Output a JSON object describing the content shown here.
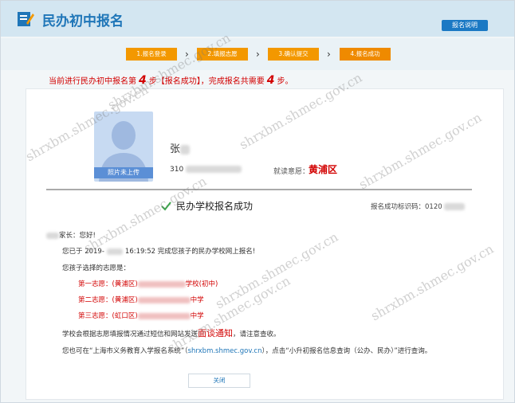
{
  "header": {
    "title": "民办初中报名",
    "help_button": "报名说明"
  },
  "steps": [
    {
      "label": "1.报名登录"
    },
    {
      "label": "2.填报志愿"
    },
    {
      "label": "3.确认提交"
    },
    {
      "label": "4.报名成功"
    }
  ],
  "progress": {
    "prefix": "当前进行民办初中报名第",
    "current": "4",
    "middle": "步【报名成功】，完成报名共需要",
    "total": "4",
    "suffix": "步。"
  },
  "student": {
    "avatar_label": "照片未上传",
    "name_visible": "张",
    "id_prefix": "310",
    "school_label": "就读意愿：",
    "school_value": "黄浦区"
  },
  "result": {
    "title": "民办学校报名成功",
    "serial_label": "报名成功标识码：",
    "serial_prefix": "0120"
  },
  "letter": {
    "greeting_suffix": "家长：您好!",
    "line1_prefix": "您已于 2019-",
    "line1_suffix": "16:19:52 完成您孩子的民办学校网上报名!",
    "choices_title": "您孩子选择的志愿是：",
    "choices": [
      {
        "prefix": "第一志愿：(黄浦区)",
        "suffix": "学校(初中)"
      },
      {
        "prefix": "第二志愿：(黄浦区)",
        "suffix": "中学"
      },
      {
        "prefix": "第三志愿：(虹口区)",
        "suffix": "中学"
      }
    ],
    "notice_prefix": "学校会根据志愿填报情况通过短信和网站发送",
    "notice_highlight": "面谈通知",
    "notice_suffix": "，请注意查收。",
    "query_prefix": "您也可在“上海市义务教育入学报名系统”（",
    "query_link": "shrxbm.shmec.gov.cn",
    "query_suffix": "），点击“小升初报名信息查询（公办、民办）”进行查询。"
  },
  "close_button": "关闭",
  "watermark": "shrxbm.shmec.gov.cn",
  "colors": {
    "brand": "#1f76b8",
    "step_orange": "#f39800",
    "alert_red": "#d20000",
    "success_green": "#3aa64a"
  }
}
